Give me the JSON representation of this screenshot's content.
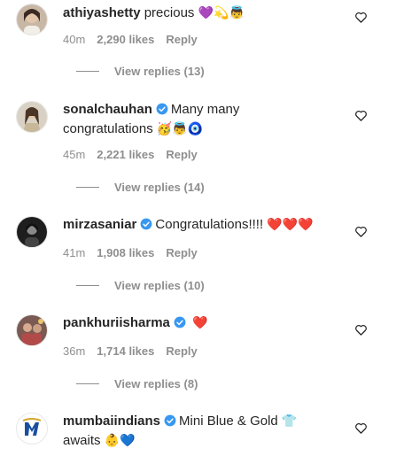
{
  "comments": [
    {
      "username": "athiyashetty",
      "verified": false,
      "text_line1": "precious",
      "emoji_line1": "💜💫👼",
      "time": "40m",
      "likes": "2,290 likes",
      "reply": "Reply",
      "view_replies": "View replies (13)"
    },
    {
      "username": "sonalchauhan",
      "verified": true,
      "text_line1": "Many many",
      "text_line2": "congratulations",
      "emoji_line2": "🥳👼🧿",
      "time": "45m",
      "likes": "2,221 likes",
      "reply": "Reply",
      "view_replies": "View replies (14)"
    },
    {
      "username": "mirzasaniar",
      "verified": true,
      "text_line1": "Congratulations!!!!",
      "emoji_line1": "❤️❤️❤️",
      "time": "41m",
      "likes": "1,908 likes",
      "reply": "Reply",
      "view_replies": "View replies (10)"
    },
    {
      "username": "pankhuriisharma",
      "verified": true,
      "text_line1": "",
      "emoji_line1": "❤️",
      "time": "36m",
      "likes": "1,714 likes",
      "reply": "Reply",
      "view_replies": "View replies (8)"
    },
    {
      "username": "mumbaiindians",
      "verified": true,
      "text_line1": "Mini Blue & Gold",
      "emoji_line1": "👕",
      "text_line2": "awaits",
      "emoji_line2": "👶💙"
    }
  ],
  "colors": {
    "text": "#262626",
    "muted": "#8e8e8e",
    "verified_blue": "#3897f0",
    "heart_red": "#ed4956"
  },
  "icons": {
    "like": "heart-outline-icon",
    "verified": "verified-badge-icon"
  }
}
